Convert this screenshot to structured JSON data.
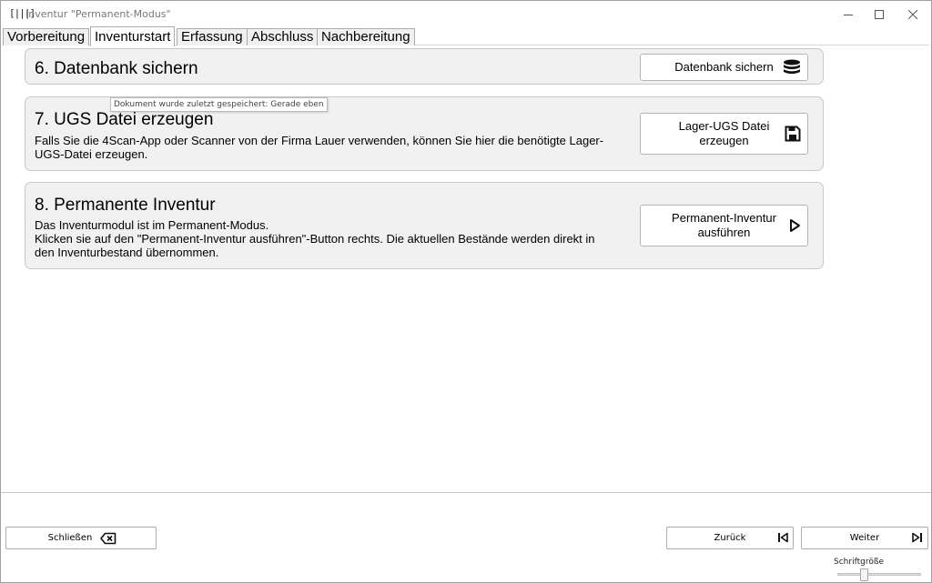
{
  "window": {
    "icon_glyph": "[|||]",
    "title": "Inventur \"Permanent-Modus\""
  },
  "tabs": [
    {
      "label": "Vorbereitung",
      "active": false
    },
    {
      "label": "Inventurstart",
      "active": true
    },
    {
      "label": "Erfassung",
      "active": false
    },
    {
      "label": "Abschluss",
      "active": false
    },
    {
      "label": "Nachbereitung",
      "active": false
    }
  ],
  "sections": {
    "backup": {
      "title": "6. Datenbank sichern",
      "button_label": "Datenbank sichern",
      "button_icon": "database-icon"
    },
    "ugs": {
      "title": "7. UGS Datei erzeugen",
      "desc_line1": "Falls Sie die 4Scan-App oder Scanner von der Firma Lauer verwenden, können Sie hier die benötigte Lager-",
      "desc_line2": "UGS-Datei erzeugen.",
      "button_line1": "Lager-UGS Datei",
      "button_line2": "erzeugen",
      "button_icon": "save-icon"
    },
    "permanent": {
      "title": "8. Permanente Inventur",
      "desc_line1": "Das Inventurmodul ist im Permanent-Modus.",
      "desc_line2": "Klicken sie auf den \"Permanent-Inventur ausführen\"-Button rechts. Die aktuellen Bestände werden direkt in",
      "desc_line3": "den Inventurbestand übernommen.",
      "button_line1": "Permanent-Inventur",
      "button_line2": "ausführen",
      "button_icon": "play-icon"
    }
  },
  "tooltip": "Dokument wurde zuletzt gespeichert: Gerade eben",
  "footer": {
    "close_label": "Schließen",
    "back_label": "Zurück",
    "next_label": "Weiter",
    "font_size_label": "Schriftgröße"
  }
}
